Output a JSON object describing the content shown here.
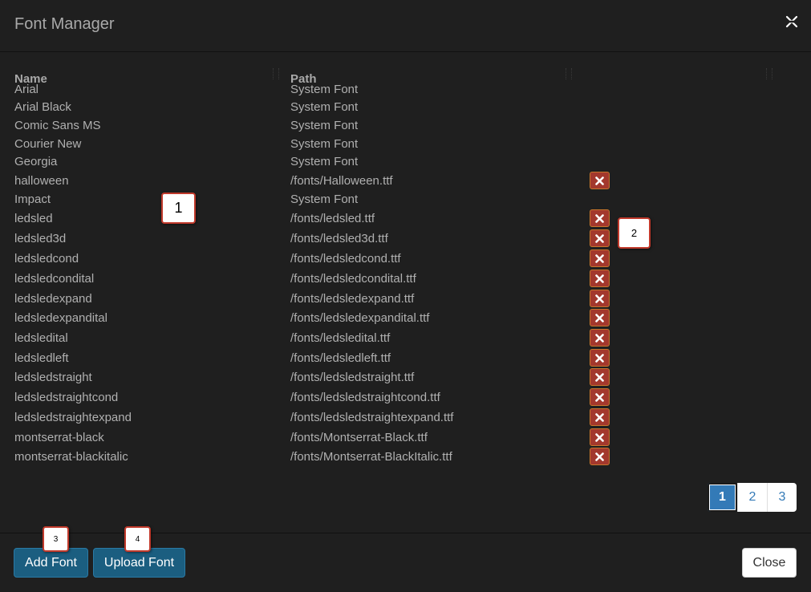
{
  "modal": {
    "title": "Font Manager",
    "close_icon": "close-x-icon"
  },
  "table": {
    "columns": [
      "Name",
      "Path"
    ],
    "rows": [
      {
        "name": "Arial",
        "path": "System Font",
        "deletable": false
      },
      {
        "name": "Arial Black",
        "path": "System Font",
        "deletable": false
      },
      {
        "name": "Comic Sans MS",
        "path": "System Font",
        "deletable": false
      },
      {
        "name": "Courier New",
        "path": "System Font",
        "deletable": false
      },
      {
        "name": "Georgia",
        "path": "System Font",
        "deletable": false
      },
      {
        "name": "halloween",
        "path": "/fonts/Halloween.ttf",
        "deletable": true
      },
      {
        "name": "Impact",
        "path": "System Font",
        "deletable": false
      },
      {
        "name": "ledsled",
        "path": "/fonts/ledsled.ttf",
        "deletable": true
      },
      {
        "name": "ledsled3d",
        "path": "/fonts/ledsled3d.ttf",
        "deletable": true
      },
      {
        "name": "ledsledcond",
        "path": "/fonts/ledsledcond.ttf",
        "deletable": true
      },
      {
        "name": "ledsledcondital",
        "path": "/fonts/ledsledcondital.ttf",
        "deletable": true
      },
      {
        "name": "ledsledexpand",
        "path": "/fonts/ledsledexpand.ttf",
        "deletable": true
      },
      {
        "name": "ledsledexpandital",
        "path": "/fonts/ledsledexpandital.ttf",
        "deletable": true
      },
      {
        "name": "ledsledital",
        "path": "/fonts/ledsledital.ttf",
        "deletable": true
      },
      {
        "name": "ledsledleft",
        "path": "/fonts/ledsledleft.ttf",
        "deletable": true
      },
      {
        "name": "ledsledstraight",
        "path": "/fonts/ledsledstraight.ttf",
        "deletable": true
      },
      {
        "name": "ledsledstraightcond",
        "path": "/fonts/ledsledstraightcond.ttf",
        "deletable": true
      },
      {
        "name": "ledsledstraightexpand",
        "path": "/fonts/ledsledstraightexpand.ttf",
        "deletable": true
      },
      {
        "name": "montserrat-black",
        "path": "/fonts/Montserrat-Black.ttf",
        "deletable": true
      },
      {
        "name": "montserrat-blackitalic",
        "path": "/fonts/Montserrat-BlackItalic.ttf",
        "deletable": true
      }
    ]
  },
  "pagination": {
    "pages": [
      "1",
      "2",
      "3"
    ],
    "active": "1"
  },
  "footer": {
    "add_font_label": "Add Font",
    "upload_font_label": "Upload Font",
    "close_label": "Close"
  },
  "callouts": [
    "1",
    "2",
    "3",
    "4"
  ],
  "colors": {
    "background": "#1f1f1f",
    "text": "#b0b0b0",
    "delete_button": "#a3382d",
    "primary_button": "#1b5e80",
    "page_active": "#337ab7",
    "callout_border": "#c0392b"
  }
}
